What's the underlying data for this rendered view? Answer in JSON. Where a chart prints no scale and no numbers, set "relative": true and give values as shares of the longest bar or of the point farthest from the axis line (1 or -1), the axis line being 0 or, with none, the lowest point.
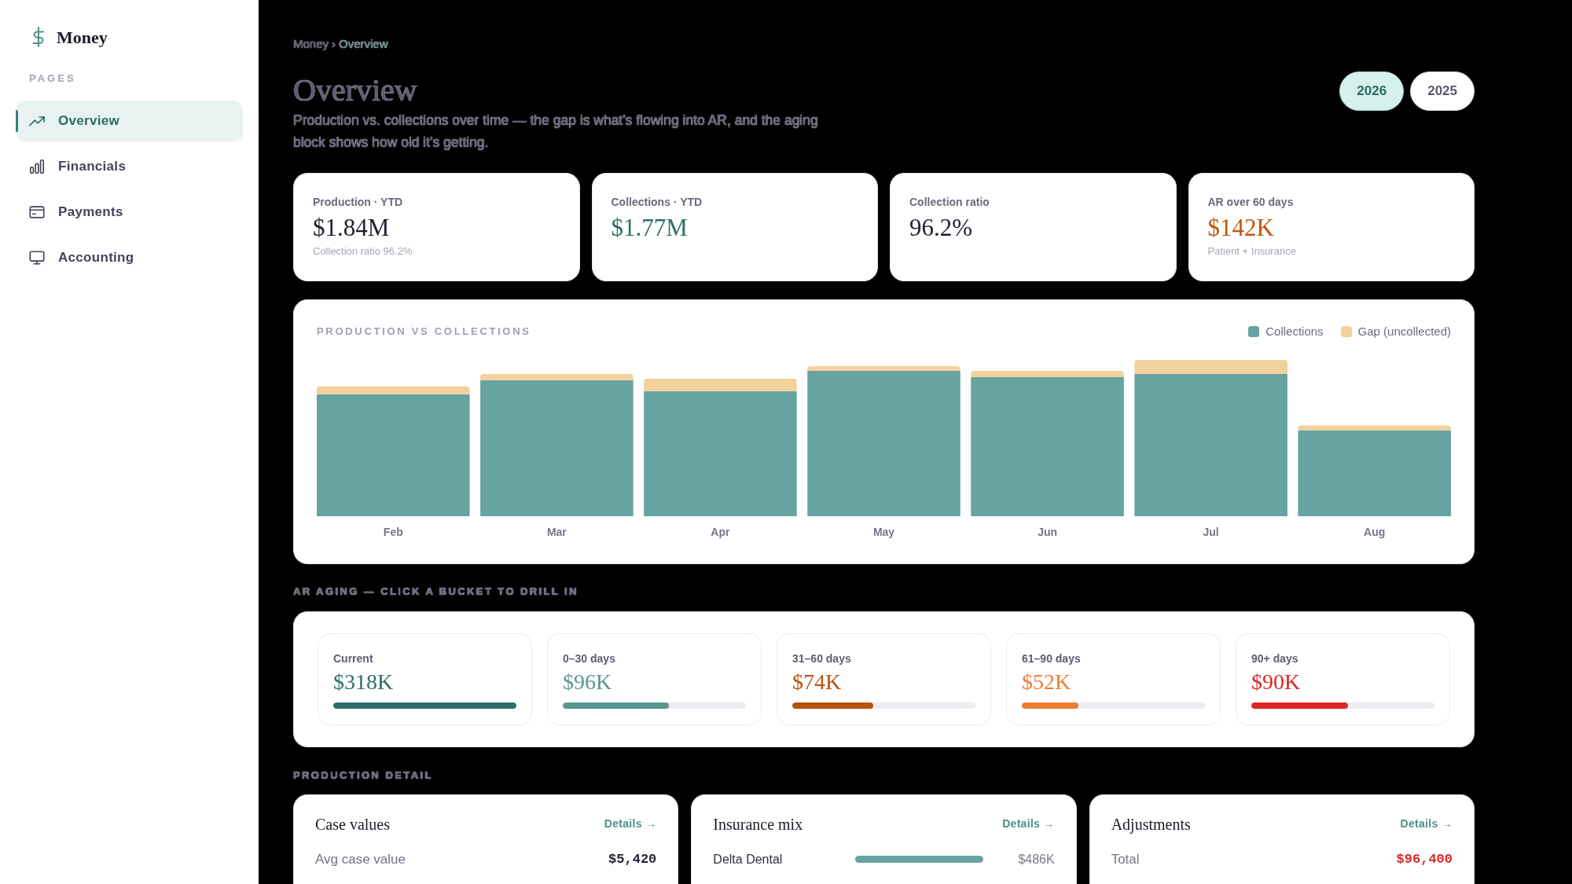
{
  "sidebar": {
    "brand": "Money",
    "section_label": "PAGES",
    "items": [
      {
        "label": "Overview",
        "selected": true
      },
      {
        "label": "Financials",
        "selected": false
      },
      {
        "label": "Payments",
        "selected": false
      },
      {
        "label": "Accounting",
        "selected": false
      }
    ]
  },
  "header": {
    "breadcrumb": {
      "parent": "Money",
      "separator": "›",
      "current": "Overview"
    },
    "title": "Overview",
    "description": "Production vs. collections over time — the gap is what's flowing into AR, and the aging block shows how old it's getting.",
    "year_options": [
      {
        "label": "2026",
        "selected": true
      },
      {
        "label": "2025",
        "selected": false
      }
    ]
  },
  "kpis": [
    {
      "label": "Production · YTD",
      "value": "$1.84M",
      "note": "Collection ratio 96.2%",
      "color": "#1f1f2e"
    },
    {
      "label": "Collections · YTD",
      "value": "$1.77M",
      "color": "#2d6e66"
    },
    {
      "label": "Collection ratio",
      "value": "96.2%",
      "color": "#1f1f2e"
    },
    {
      "label": "AR over 60 days",
      "value": "$142K",
      "note": "Patient + Insurance",
      "color": "#c0560f"
    }
  ],
  "chart": {
    "chart_data": {
      "type": "bar",
      "title": "PRODUCTION VS COLLECTIONS",
      "stacked": true,
      "relative": true,
      "categories": [
        "Feb",
        "Mar",
        "Apr",
        "May",
        "Jun",
        "Jul",
        "Aug"
      ],
      "series": [
        {
          "name": "Collections",
          "color": "#67a3a0",
          "values": [
            0.78,
            0.87,
            0.8,
            0.93,
            0.89,
            0.91,
            0.55
          ]
        },
        {
          "name": "Gap (uncollected)",
          "color": "#f3d19c",
          "values": [
            0.05,
            0.04,
            0.08,
            0.03,
            0.04,
            0.09,
            0.03
          ]
        }
      ]
    }
  },
  "aging": {
    "heading": "AR AGING — CLICK A BUCKET TO DRILL IN",
    "buckets": [
      {
        "label": "Current",
        "value": "$318K",
        "color": "#2d6e66",
        "level": 1.0
      },
      {
        "label": "0–30 days",
        "value": "$96K",
        "color": "#5b9790",
        "level": 0.58
      },
      {
        "label": "31–60 days",
        "value": "$74K",
        "color": "#b8520f",
        "level": 0.44
      },
      {
        "label": "61–90 days",
        "value": "$52K",
        "color": "#ee7d33",
        "level": 0.31
      },
      {
        "label": "90+ days",
        "value": "$90K",
        "color": "#dc2626",
        "level": 0.53
      }
    ]
  },
  "production_detail": {
    "heading": "PRODUCTION DETAIL",
    "cards": [
      {
        "title": "Case values",
        "link": "Details →",
        "rows": [
          {
            "kind": "value",
            "label": "Avg case value",
            "value": "$5,420",
            "color": "#1f1f2e"
          }
        ]
      },
      {
        "title": "Insurance mix",
        "link": "Details →",
        "rows": [
          {
            "kind": "bar",
            "label": "Delta Dental",
            "level": 1.0,
            "value": "$486K"
          }
        ]
      },
      {
        "title": "Adjustments",
        "link": "Details →",
        "rows": [
          {
            "kind": "value",
            "label": "Total",
            "value": "$96,400",
            "color": "#dc2626"
          }
        ]
      }
    ]
  }
}
